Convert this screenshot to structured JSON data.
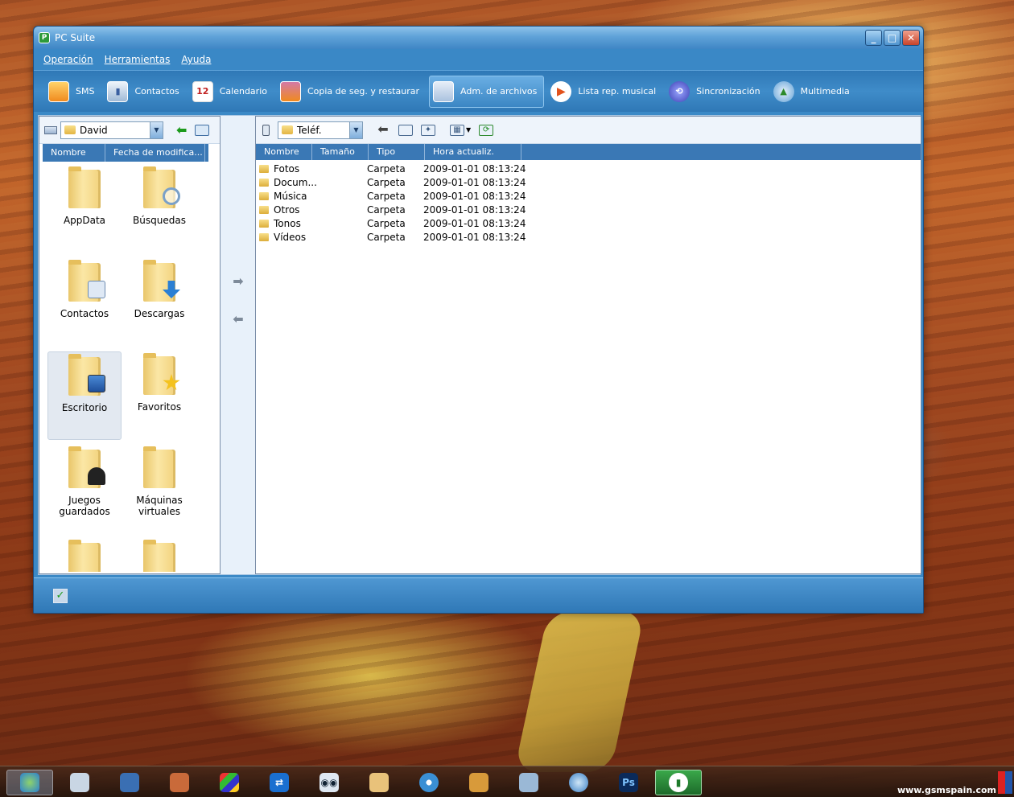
{
  "window": {
    "title": "PC Suite",
    "buttons": {
      "minimize": "_",
      "maximize": "□",
      "close": "✕"
    }
  },
  "menu": [
    "Operación",
    "Herramientas",
    "Ayuda"
  ],
  "toolbar": [
    {
      "label": "SMS",
      "icon": "sms-icon"
    },
    {
      "label": "Contactos",
      "icon": "contacts-icon"
    },
    {
      "label": "Calendario",
      "icon": "calendar-icon",
      "badge": "12"
    },
    {
      "label": "Copia de seg. y restaurar",
      "icon": "backup-icon"
    },
    {
      "label": "Adm. de archivos",
      "icon": "file-manager-icon",
      "active": true
    },
    {
      "label": "Lista rep. musical",
      "icon": "playlist-icon"
    },
    {
      "label": "Sincronización",
      "icon": "sync-icon"
    },
    {
      "label": "Multimedia",
      "icon": "multimedia-icon"
    }
  ],
  "left": {
    "location": "David",
    "columns": [
      "Nombre",
      "Fecha de modifica..."
    ],
    "folders": [
      {
        "name": "AppData",
        "icon": "folder-icon"
      },
      {
        "name": "Búsquedas",
        "icon": "search-folder-icon"
      },
      {
        "name": "Contactos",
        "icon": "contacts-folder-icon"
      },
      {
        "name": "Descargas",
        "icon": "downloads-folder-icon"
      },
      {
        "name": "Escritorio",
        "icon": "desktop-folder-icon",
        "selected": true
      },
      {
        "name": "Favoritos",
        "icon": "favorites-folder-icon"
      },
      {
        "name": "Juegos guardados",
        "icon": "saved-games-folder-icon"
      },
      {
        "name": "Máquinas virtuales",
        "icon": "virtual-machines-folder-icon"
      }
    ]
  },
  "right": {
    "location": "Teléf.",
    "columns": [
      "Nombre",
      "Tamaño",
      "Tipo",
      "Hora actualiz."
    ],
    "rows": [
      {
        "name": "Fotos",
        "type": "Carpeta",
        "date": "2009-01-01 08:13:24"
      },
      {
        "name": "Docum...",
        "type": "Carpeta",
        "date": "2009-01-01 08:13:24"
      },
      {
        "name": "Música",
        "type": "Carpeta",
        "date": "2009-01-01 08:13:24"
      },
      {
        "name": "Otros",
        "type": "Carpeta",
        "date": "2009-01-01 08:13:24"
      },
      {
        "name": "Tonos",
        "type": "Carpeta",
        "date": "2009-01-01 08:13:24"
      },
      {
        "name": "Vídeos",
        "type": "Carpeta",
        "date": "2009-01-01 08:13:24"
      }
    ]
  },
  "taskbar": {
    "watermark": "www.gsmspain.com",
    "items": [
      "start-orb-icon",
      "pen-icon",
      "castle-icon",
      "chess-icon",
      "windows-flag-icon",
      "teamviewer-icon",
      "eyes-icon",
      "paint-palette-icon",
      "disc-icon",
      "media-film-icon",
      "tablet-icon",
      "globe-icon",
      "photoshop-icon",
      "pc-suite-icon"
    ],
    "photoshop_label": "Ps",
    "calendar_badge": "12"
  }
}
